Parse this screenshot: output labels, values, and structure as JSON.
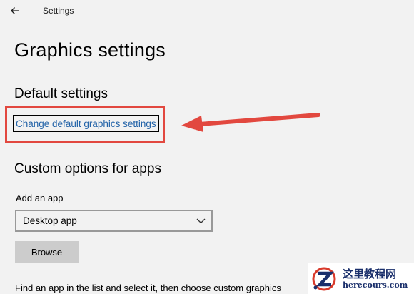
{
  "window": {
    "title": "Settings",
    "back_icon": "back-arrow-icon"
  },
  "page": {
    "title": "Graphics settings"
  },
  "default_section": {
    "title": "Default settings",
    "link_label": "Change default graphics settings"
  },
  "annotation": {
    "box_color": "#e2483f",
    "arrow_color": "#e2483f"
  },
  "custom_section": {
    "title": "Custom options for apps",
    "add_app_label": "Add an app",
    "app_type_selected": "Desktop app",
    "browse_label": "Browse",
    "help_text": "Find an app in the list and select it, then choose custom graphics"
  },
  "watermark": {
    "text_cn": "这里教程网",
    "url": "herecours.com"
  },
  "colors": {
    "background": "#f2f2f2",
    "link": "#2363a8",
    "button_bg": "#cccccc"
  }
}
